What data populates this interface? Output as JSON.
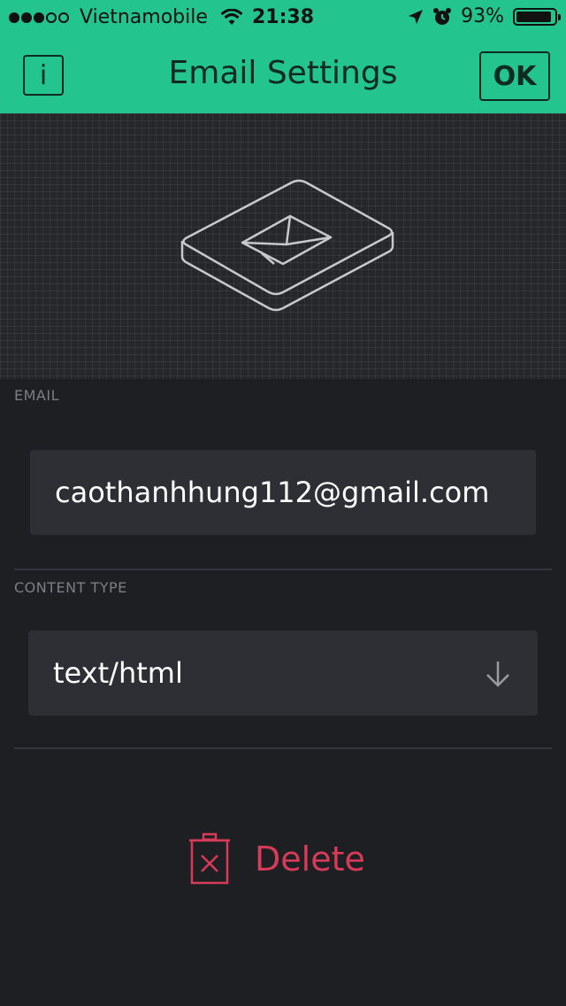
{
  "status_bar": {
    "carrier": "Vietnamobile",
    "time": "21:38",
    "battery_percent": "93%",
    "battery_level": 0.93
  },
  "header": {
    "info_label": "i",
    "title": "Email Settings",
    "ok_label": "OK"
  },
  "preview": {
    "icon": "email-widget-icon"
  },
  "email_section": {
    "label": "EMAIL",
    "value": "caothanhhung112@gmail.com"
  },
  "content_type_section": {
    "label": "CONTENT TYPE",
    "selected": "text/html"
  },
  "delete": {
    "label": "Delete"
  },
  "colors": {
    "accent": "#23c48e",
    "background": "#1e1f23",
    "field": "#2e2f34",
    "danger": "#d83b58"
  }
}
